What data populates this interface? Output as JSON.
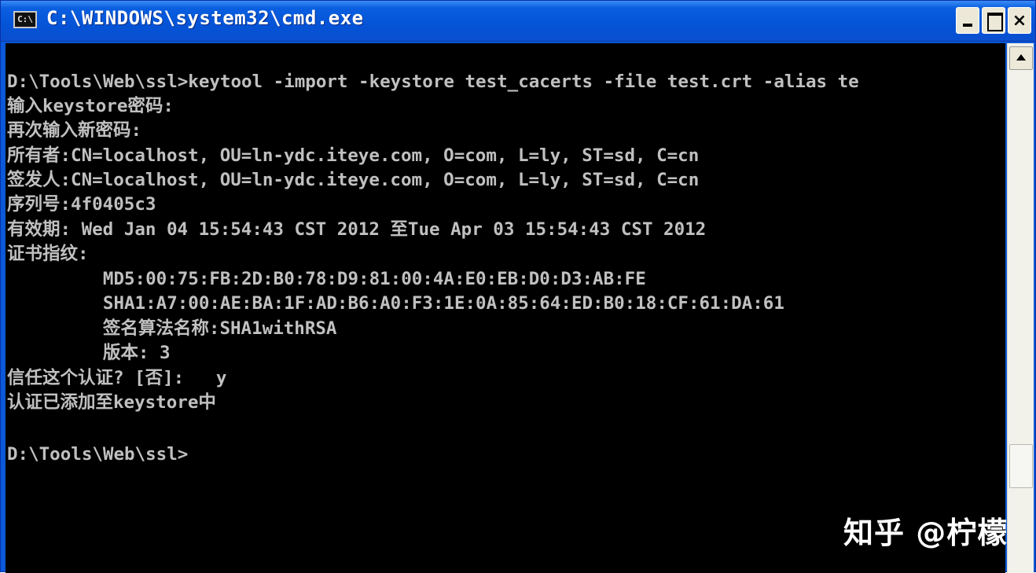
{
  "window": {
    "title": "C:\\WINDOWS\\system32\\cmd.exe",
    "icon_label": "C:\\",
    "icon": "console-icon",
    "controls": [
      "minimize-icon",
      "maximize-icon",
      "close-icon"
    ],
    "close_label": "×"
  },
  "console": {
    "lines": [
      "D:\\Tools\\Web\\ssl>keytool -import -keystore test_cacerts -file test.crt -alias te",
      "输入keystore密码:",
      "再次输入新密码:",
      "所有者:CN=localhost, OU=ln-ydc.iteye.com, O=com, L=ly, ST=sd, C=cn",
      "签发人:CN=localhost, OU=ln-ydc.iteye.com, O=com, L=ly, ST=sd, C=cn",
      "序列号:4f0405c3",
      "有效期: Wed Jan 04 15:54:43 CST 2012 至Tue Apr 03 15:54:43 CST 2012",
      "证书指纹:",
      "         MD5:00:75:FB:2D:B0:78:D9:81:00:4A:E0:EB:D0:D3:AB:FE",
      "         SHA1:A7:00:AE:BA:1F:AD:B6:A0:F3:1E:0A:85:64:ED:B0:18:CF:61:DA:61",
      "         签名算法名称:SHA1withRSA",
      "         版本: 3",
      "信任这个认证? [否]:   y",
      "认证已添加至keystore中",
      "",
      "D:\\Tools\\Web\\ssl>"
    ]
  },
  "watermark": "知乎 @柠檬",
  "colors": {
    "titlebar": "#0553d6",
    "console_bg": "#000000",
    "console_text": "#c0c0c0",
    "scrollbar_bg": "#f2f1ea"
  }
}
